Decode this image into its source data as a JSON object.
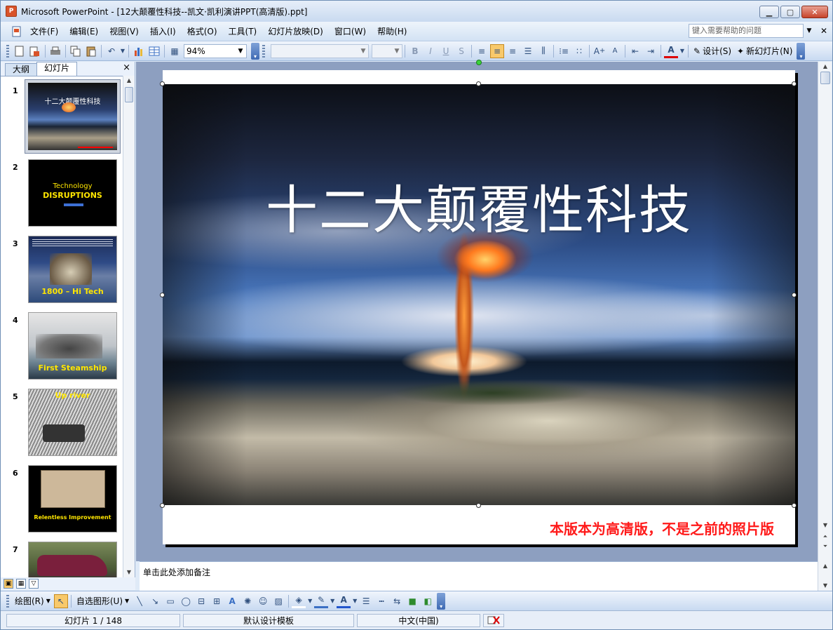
{
  "window": {
    "app_logo": "P",
    "title": "Microsoft PowerPoint - [12大颠覆性科技--凯文·凯利演讲PPT(高清版).ppt]",
    "minimize": "▁",
    "maximize": "▢",
    "close": "✕"
  },
  "menu": {
    "items": [
      "文件(F)",
      "编辑(E)",
      "视图(V)",
      "插入(I)",
      "格式(O)",
      "工具(T)",
      "幻灯片放映(D)",
      "窗口(W)",
      "帮助(H)"
    ],
    "help_placeholder": "键入需要帮助的问题",
    "help_arrow": "▼",
    "doc_close": "✕"
  },
  "toolbar": {
    "zoom": "94%",
    "zoom_arrow": "▼",
    "design_label": "设计(S)",
    "new_slide_label": "新幻灯片(N)"
  },
  "left_pane": {
    "tabs": [
      "大纲",
      "幻灯片"
    ],
    "close": "×",
    "thumbnails": [
      {
        "num": "1",
        "title": "十二大颠覆性科技",
        "caption": ""
      },
      {
        "num": "2",
        "title": "Technology",
        "caption": "DISRUPTIONS"
      },
      {
        "num": "3",
        "title": "1800 – Hi Tech",
        "caption": ""
      },
      {
        "num": "4",
        "title": "First Steamship",
        "caption": ""
      },
      {
        "num": "5",
        "title": "Up river",
        "caption": ""
      },
      {
        "num": "6",
        "title": "Relentless Improvement",
        "caption": ""
      },
      {
        "num": "7",
        "title": "",
        "caption": ""
      }
    ]
  },
  "slide": {
    "title": "十二大颠覆性科技",
    "note": "本版本为高清版，不是之前的照片版"
  },
  "notes": {
    "placeholder": "单击此处添加备注"
  },
  "drawbar": {
    "draw_label": "绘图(R)",
    "autoshape_label": "自选图形(U)"
  },
  "status": {
    "slide_pos": "幻灯片 1 / 148",
    "template": "默认设计模板",
    "language": "中文(中国)"
  },
  "colors": {
    "slide_note": "#ff1a1a",
    "selected_button": "#f8c96b",
    "title_bar": "#c9daf0"
  }
}
